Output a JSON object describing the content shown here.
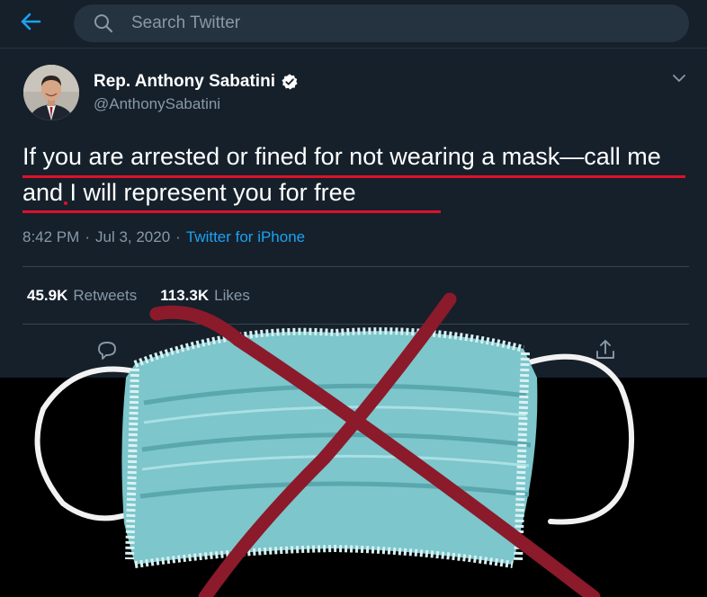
{
  "search": {
    "placeholder": "Search Twitter"
  },
  "tweet": {
    "author_name": "Rep. Anthony Sabatini",
    "author_handle": "@AnthonySabatini",
    "text": "If you are arrested or fined for not wearing a mask—call me and I will represent you for free",
    "time": "8:42 PM",
    "date": "Jul 3, 2020",
    "separator": "·",
    "source": "Twitter for iPhone",
    "retweets_value": "45.9K",
    "retweets_label": "Retweets",
    "likes_value": "113.3K",
    "likes_label": "Likes"
  },
  "icons": {
    "back": "back-arrow-icon",
    "search": "search-icon",
    "verified": "verified-badge-icon",
    "more": "chevron-down-icon",
    "reply": "reply-icon",
    "share": "share-icon"
  },
  "colors": {
    "background": "#15202b",
    "accent": "#1da1f2",
    "secondary_text": "#8899a6",
    "underline_red": "#e0102c",
    "cross_red": "#8b1a2b",
    "mask_teal": "#7cc6cc"
  },
  "overlay": {
    "image": "surgical mask crossed out"
  }
}
